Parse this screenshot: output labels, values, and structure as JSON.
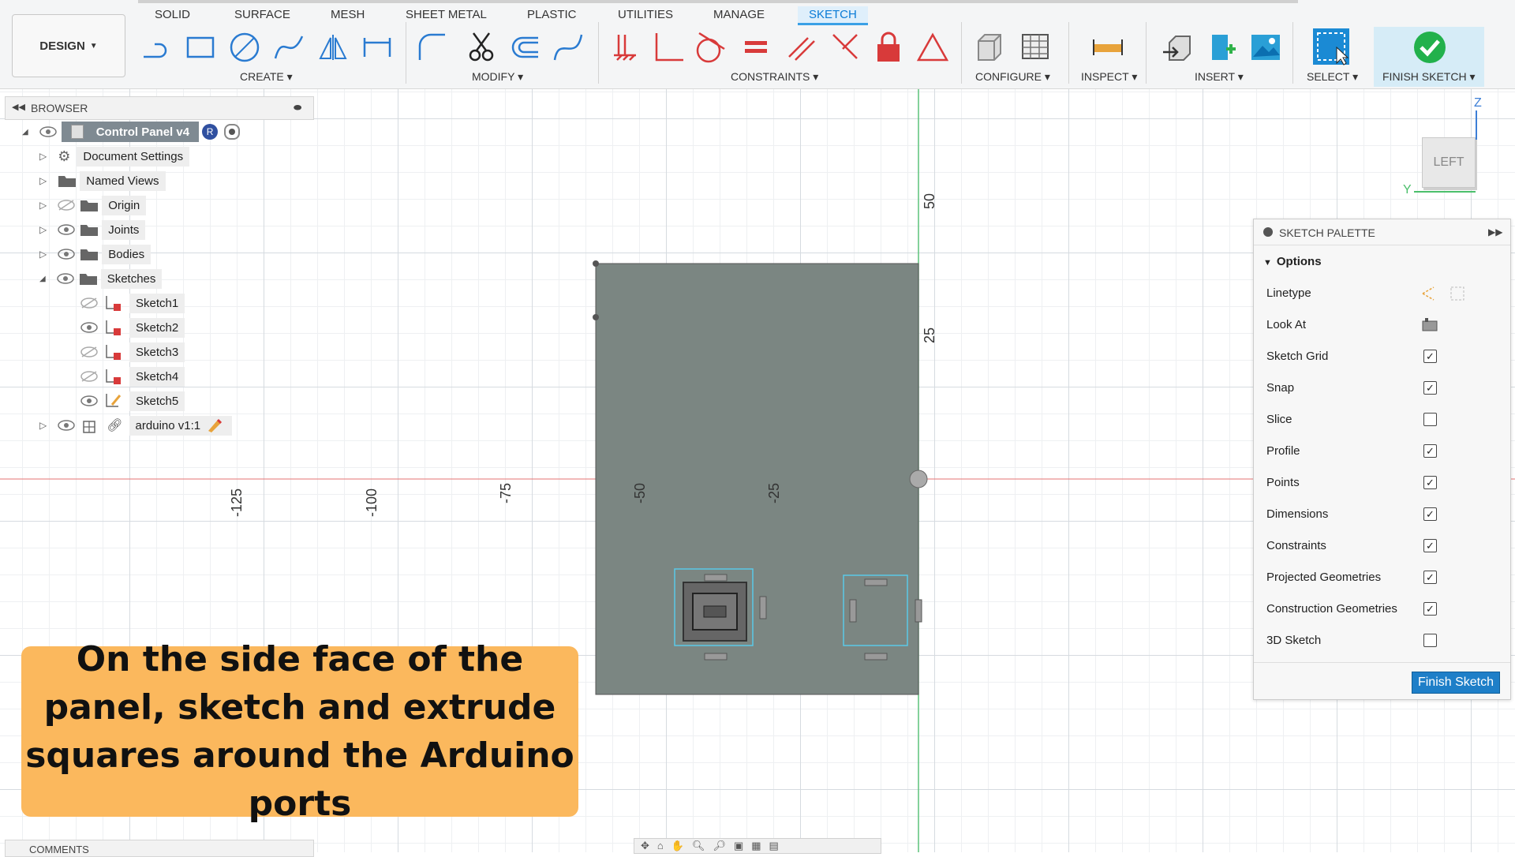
{
  "toolbar": {
    "workspace": "DESIGN",
    "tabs": [
      "SOLID",
      "SURFACE",
      "MESH",
      "SHEET METAL",
      "PLASTIC",
      "UTILITIES",
      "MANAGE",
      "SKETCH"
    ],
    "active_tab": "SKETCH",
    "groups": {
      "create": "CREATE",
      "modify": "MODIFY",
      "constraints": "CONSTRAINTS",
      "configure": "CONFIGURE",
      "inspect": "INSPECT",
      "insert": "INSERT",
      "select": "SELECT",
      "finish": "FINISH SKETCH"
    },
    "accent": "#0a7bd6"
  },
  "browser": {
    "title": "BROWSER",
    "root": "Control Panel v4",
    "root_badge": "R",
    "items": [
      {
        "label": "Document Settings",
        "icon": "gear-icon"
      },
      {
        "label": "Named Views",
        "icon": "folder-icon"
      },
      {
        "label": "Origin",
        "icon": "folder-icon",
        "visible": false
      },
      {
        "label": "Joints",
        "icon": "folder-icon"
      },
      {
        "label": "Bodies",
        "icon": "folder-icon"
      },
      {
        "label": "Sketches",
        "icon": "folder-icon",
        "expanded": true
      }
    ],
    "sketches": [
      {
        "label": "Sketch1",
        "visible": false
      },
      {
        "label": "Sketch2",
        "visible": true
      },
      {
        "label": "Sketch3",
        "visible": false
      },
      {
        "label": "Sketch4",
        "visible": false
      },
      {
        "label": "Sketch5",
        "visible": true,
        "editing": true
      }
    ],
    "component": "arduino v1:1"
  },
  "viewport": {
    "x_ticks": [
      "-125",
      "-100",
      "-75",
      "-50",
      "-25"
    ],
    "y_ticks": [
      "50",
      "25"
    ],
    "viewcube": {
      "face": "LEFT",
      "z": "Z",
      "y": "Y"
    },
    "panel_color": "#7b8682"
  },
  "palette": {
    "title": "SKETCH PALETTE",
    "section": "Options",
    "rows": [
      {
        "label": "Linetype",
        "type": "icons"
      },
      {
        "label": "Look At",
        "type": "icon"
      },
      {
        "label": "Sketch Grid",
        "type": "check",
        "checked": true
      },
      {
        "label": "Snap",
        "type": "check",
        "checked": true
      },
      {
        "label": "Slice",
        "type": "check",
        "checked": false
      },
      {
        "label": "Profile",
        "type": "check",
        "checked": true
      },
      {
        "label": "Points",
        "type": "check",
        "checked": true
      },
      {
        "label": "Dimensions",
        "type": "check",
        "checked": true
      },
      {
        "label": "Constraints",
        "type": "check",
        "checked": true
      },
      {
        "label": "Projected Geometries",
        "type": "check",
        "checked": true
      },
      {
        "label": "Construction Geometries",
        "type": "check",
        "checked": true
      },
      {
        "label": "3D Sketch",
        "type": "check",
        "checked": false
      }
    ],
    "finish_button": "Finish Sketch"
  },
  "caption": {
    "text": "On the side face of the panel, sketch and extrude squares around the Arduino ports",
    "bg": "#fbb85d"
  },
  "comments": {
    "title": "COMMENTS"
  }
}
